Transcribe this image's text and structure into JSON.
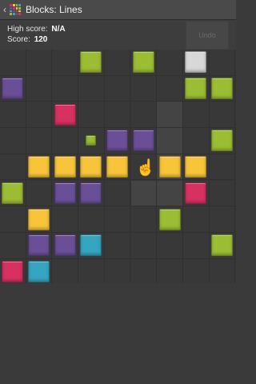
{
  "header": {
    "title": "Blocks: Lines",
    "back_icon": "chevron-left-icon",
    "app_icon": "grid-logo-icon"
  },
  "scores": {
    "high_label": "High score:",
    "high_value": "N/A",
    "score_label": "Score:",
    "score_value": "120"
  },
  "undo_label": "Undo",
  "colors": {
    "green": "#9bbd34",
    "purple": "#6a4f97",
    "pink": "#d63161",
    "yellow": "#f7c43a",
    "blue": "#36a5c0",
    "white": "#d8d8d8"
  },
  "board": {
    "cols": 9,
    "rows": 9,
    "highlight_cells": [
      [
        2,
        6
      ],
      [
        3,
        6
      ],
      [
        4,
        6
      ],
      [
        5,
        5
      ],
      [
        5,
        6
      ]
    ],
    "blocks": [
      {
        "row": 0,
        "col": 3,
        "color": "green"
      },
      {
        "row": 0,
        "col": 5,
        "color": "green"
      },
      {
        "row": 0,
        "col": 7,
        "color": "white"
      },
      {
        "row": 1,
        "col": 0,
        "color": "purple"
      },
      {
        "row": 1,
        "col": 7,
        "color": "green"
      },
      {
        "row": 1,
        "col": 8,
        "color": "green"
      },
      {
        "row": 2,
        "col": 2,
        "color": "pink"
      },
      {
        "row": 3,
        "col": 3,
        "color": "green",
        "small": true
      },
      {
        "row": 3,
        "col": 4,
        "color": "purple"
      },
      {
        "row": 3,
        "col": 5,
        "color": "purple"
      },
      {
        "row": 3,
        "col": 8,
        "color": "green"
      },
      {
        "row": 4,
        "col": 1,
        "color": "yellow"
      },
      {
        "row": 4,
        "col": 2,
        "color": "yellow"
      },
      {
        "row": 4,
        "col": 3,
        "color": "yellow"
      },
      {
        "row": 4,
        "col": 4,
        "color": "yellow"
      },
      {
        "row": 4,
        "col": 6,
        "color": "yellow"
      },
      {
        "row": 4,
        "col": 7,
        "color": "yellow"
      },
      {
        "row": 5,
        "col": 0,
        "color": "green"
      },
      {
        "row": 5,
        "col": 2,
        "color": "purple"
      },
      {
        "row": 5,
        "col": 3,
        "color": "purple"
      },
      {
        "row": 5,
        "col": 7,
        "color": "pink"
      },
      {
        "row": 6,
        "col": 1,
        "color": "yellow"
      },
      {
        "row": 6,
        "col": 6,
        "color": "green"
      },
      {
        "row": 7,
        "col": 1,
        "color": "purple"
      },
      {
        "row": 7,
        "col": 2,
        "color": "purple"
      },
      {
        "row": 7,
        "col": 3,
        "color": "blue"
      },
      {
        "row": 7,
        "col": 8,
        "color": "green"
      },
      {
        "row": 8,
        "col": 0,
        "color": "pink"
      },
      {
        "row": 8,
        "col": 1,
        "color": "blue"
      }
    ]
  },
  "cursor": {
    "row": 4,
    "col": 5,
    "icon": "hand-pointer-icon"
  }
}
